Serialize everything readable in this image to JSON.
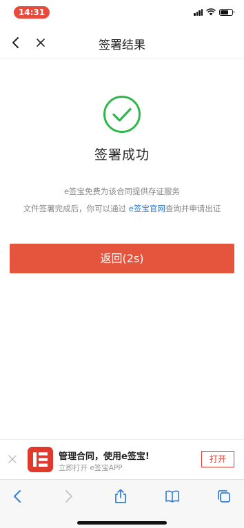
{
  "status_bar": {
    "time": "14:31"
  },
  "nav": {
    "title": "签署结果",
    "back_icon": "chevron-left-icon",
    "close_icon": "close-icon"
  },
  "result": {
    "icon": "check-circle-icon",
    "title": "签署成功",
    "info_line1": "e签宝免费为该合同提供存证服务",
    "info_line2_prefix": "文件签署完成后，你可以通过",
    "info_line2_link": "e签宝官网",
    "info_line2_suffix": "查询并申请出证",
    "success_color": "#2eb84a",
    "link_color": "#2f7bd9"
  },
  "return_button": {
    "label": "返回(2s)",
    "color": "#e5543d"
  },
  "app_banner": {
    "title": "管理合同，使用e签宝!",
    "subtitle": "立即打开 e签宝APP",
    "open_label": "打开",
    "brand_color": "#e03a2f"
  },
  "browser_toolbar": {
    "icons": [
      "back-arrow-icon",
      "forward-arrow-icon",
      "share-icon",
      "bookmarks-icon",
      "tabs-icon"
    ]
  }
}
